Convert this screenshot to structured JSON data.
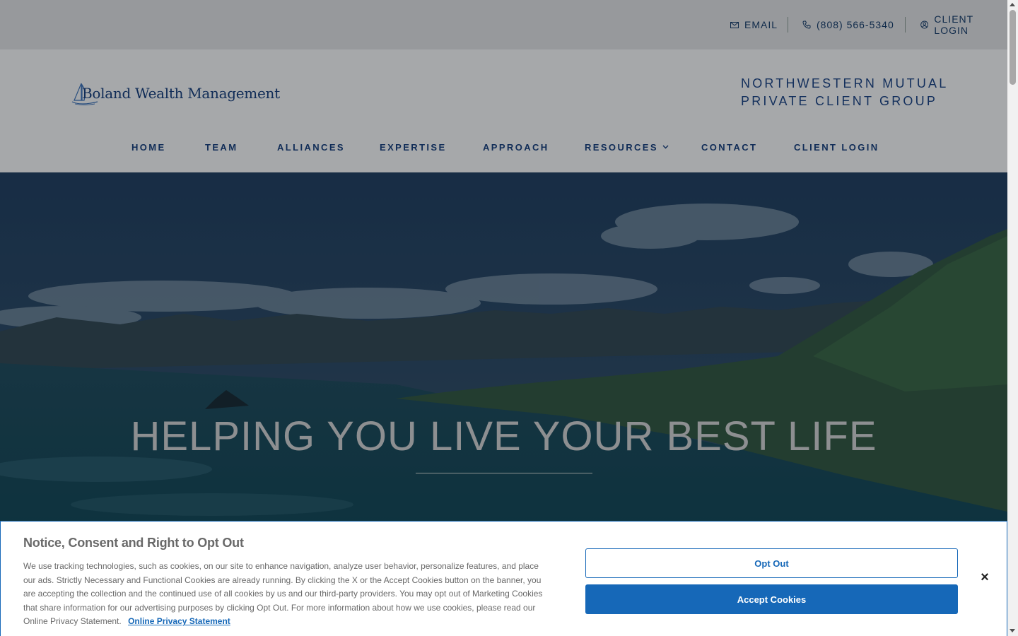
{
  "utility_bar": {
    "email_label": "EMAIL",
    "phone_label": "(808) 566-5340",
    "client_login_label": "CLIENT LOGIN"
  },
  "header": {
    "logo_text": "Boland Wealth Management",
    "group_line1": "NORTHWESTERN MUTUAL",
    "group_line2": "PRIVATE CLIENT GROUP"
  },
  "nav": {
    "items": [
      {
        "label": "HOME"
      },
      {
        "label": "TEAM"
      },
      {
        "label": "ALLIANCES"
      },
      {
        "label": "EXPERTISE"
      },
      {
        "label": "APPROACH"
      },
      {
        "label": "RESOURCES",
        "icon": "chevron-down-icon"
      },
      {
        "label": "CONTACT"
      },
      {
        "label": "CLIENT LOGIN"
      }
    ]
  },
  "hero": {
    "headline": "HELPING YOU LIVE YOUR BEST LIFE"
  },
  "cookie_banner": {
    "title": "Notice, Consent and Right to Opt Out",
    "body": "We use tracking technologies, such as cookies, on our site to enhance navigation, analyze user behavior, personalize features, and place our ads. Strictly Necessary and Functional Cookies are already running. By clicking the X or the Accept Cookies button on the banner, you are accepting the collection and the continued use of all cookies by us and our third-party providers. You may opt out of Marketing Cookies that share information for our advertising purposes by clicking Opt Out. For more information about how we use cookies, please read our Online Privacy Statement.",
    "privacy_link": "Online Privacy Statement",
    "opt_out_label": "Opt Out",
    "accept_label": "Accept Cookies",
    "close_icon": "×"
  },
  "colors": {
    "brand_navy": "#102c57",
    "accent_blue": "#1668b8"
  }
}
